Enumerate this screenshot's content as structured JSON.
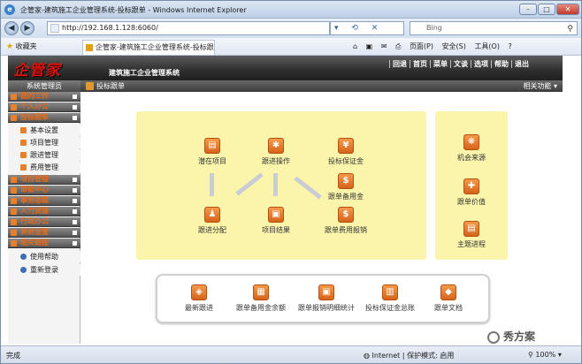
{
  "window": {
    "title": "企管家-建筑施工企业管理系统-投标跟单 - Windows Internet Explorer",
    "min": "–",
    "max": "□",
    "close": "✕"
  },
  "address": {
    "url": "http://192.168.1.128:6060/",
    "search_placeholder": "Bing",
    "icons": "▾ ⟲ ✕"
  },
  "favbar": {
    "favorites": "收藏夹",
    "tab": "企管家-建筑施工企业管理系统-投标跟单",
    "tools": [
      "页面(P)",
      "安全(S)",
      "工具(O)",
      "?"
    ]
  },
  "app": {
    "logo": "企管家",
    "system_name": "建筑施工企业管理系统",
    "top_menu": [
      "回退",
      "首页",
      "菜单",
      "文谈",
      "选项",
      "帮助",
      "退出"
    ],
    "sidebar_title": "系统管理员",
    "breadcrumb": "投标跟单",
    "related": "相关功能 ▾"
  },
  "sidebar": {
    "groups_top": [
      "我的工作",
      "个人办公",
      "投标跟单"
    ],
    "subitems": [
      "基本设置",
      "项目管理",
      "跟进管理",
      "费用管理"
    ],
    "groups_bottom": [
      "项目管理",
      "审批中心",
      "事务总裁",
      "人力资源",
      "行政办公",
      "系统设置",
      "相关链接"
    ],
    "links": [
      "使用帮助",
      "重新登录"
    ]
  },
  "flow": {
    "nodes": [
      {
        "label": "潜在项目",
        "glyph": "▤"
      },
      {
        "label": "跟进操作",
        "glyph": "✱"
      },
      {
        "label": "投标保证金",
        "glyph": "¥"
      },
      {
        "label": "跟单备用金",
        "glyph": "$"
      },
      {
        "label": "跟进分配",
        "glyph": "♟"
      },
      {
        "label": "项目结果",
        "glyph": "▣"
      },
      {
        "label": "跟单费用报销",
        "glyph": "$"
      }
    ],
    "side": [
      {
        "label": "机会来源",
        "glyph": "❋"
      },
      {
        "label": "跟单价值",
        "glyph": "✚"
      },
      {
        "label": "主题进程",
        "glyph": "▤"
      }
    ],
    "reports": [
      {
        "label": "最新跟进",
        "glyph": "◈"
      },
      {
        "label": "跟单备用金余额",
        "glyph": "▦"
      },
      {
        "label": "跟单报销明细统计",
        "glyph": "▣"
      },
      {
        "label": "投标保证金总账",
        "glyph": "▥"
      },
      {
        "label": "跟单文档",
        "glyph": "◆"
      }
    ]
  },
  "status": {
    "left": "完成",
    "zone": "Internet | 保护模式: 启用",
    "zoom": "100%",
    "watermark": "秀方案"
  },
  "colors": {
    "accent": "#e8802a",
    "panel": "#fbf5ac",
    "header": "#2e2e2e"
  }
}
